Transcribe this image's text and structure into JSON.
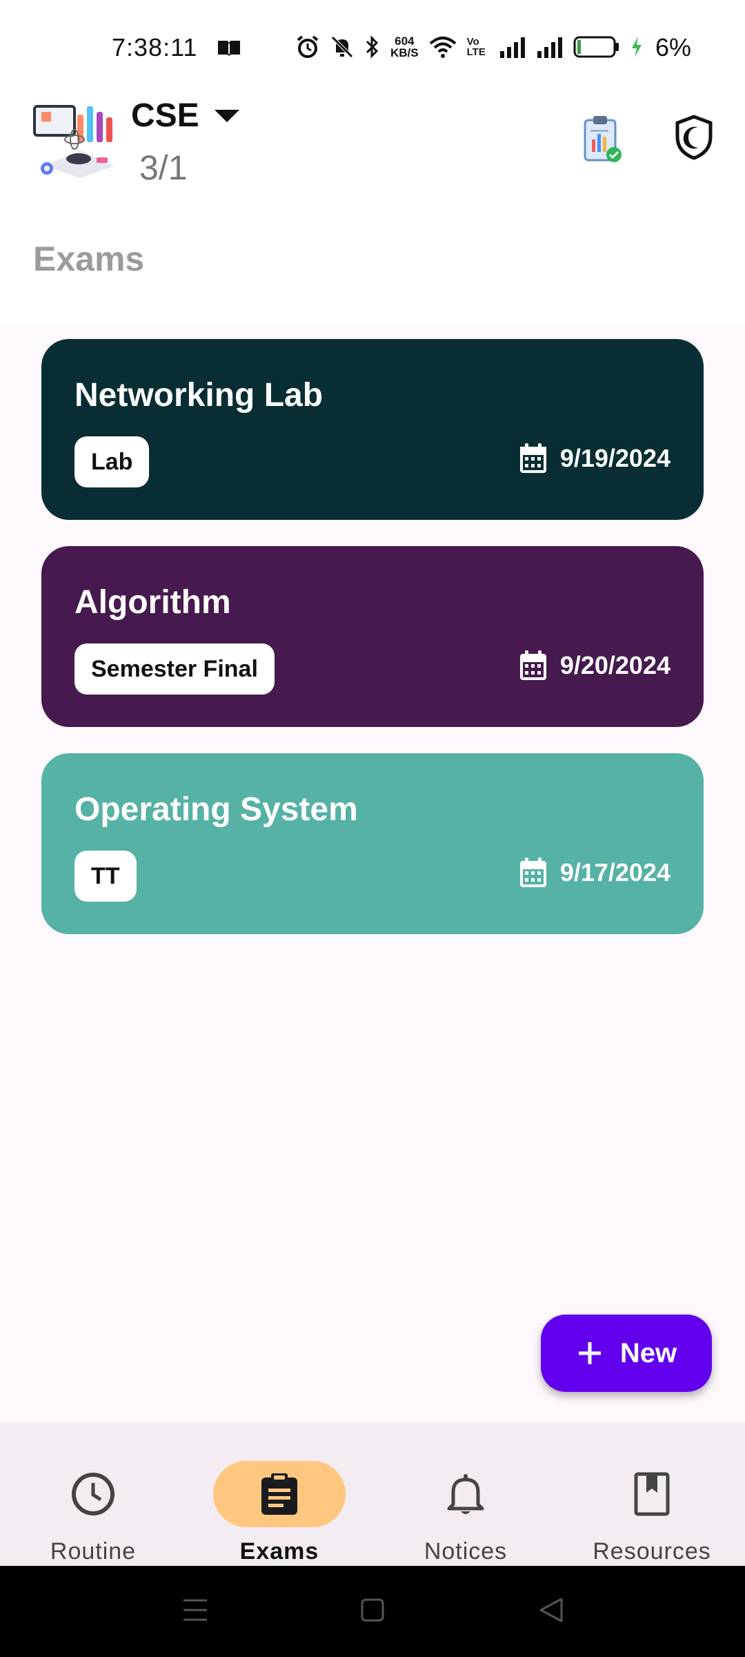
{
  "status_bar": {
    "time": "7:38:11",
    "net_speed_value": "604",
    "net_speed_unit": "KB/S",
    "volte": "Vo LTE",
    "battery_percent": "6%"
  },
  "header": {
    "department": "CSE",
    "semester": "3/1"
  },
  "page": {
    "title": "Exams"
  },
  "exams": [
    {
      "title": "Networking Lab",
      "type": "Lab",
      "date": "9/19/2024",
      "color": "#082e33"
    },
    {
      "title": "Algorithm",
      "type": "Semester Final",
      "date": "9/20/2024",
      "color": "#461a4e"
    },
    {
      "title": "Operating System",
      "type": "TT",
      "date": "9/17/2024",
      "color": "#55b2a4"
    }
  ],
  "fab": {
    "label": "New"
  },
  "bottom_nav": {
    "items": [
      {
        "label": "Routine",
        "icon": "clock-icon"
      },
      {
        "label": "Exams",
        "icon": "clipboard-icon",
        "active": true
      },
      {
        "label": "Notices",
        "icon": "bell-icon"
      },
      {
        "label": "Resources",
        "icon": "bookmark-book-icon"
      }
    ]
  },
  "colors": {
    "background": "#fdf8fc",
    "fab": "#6200ee",
    "nav_active_pill": "#ffc77f",
    "nav_bar": "#f3edf3"
  }
}
